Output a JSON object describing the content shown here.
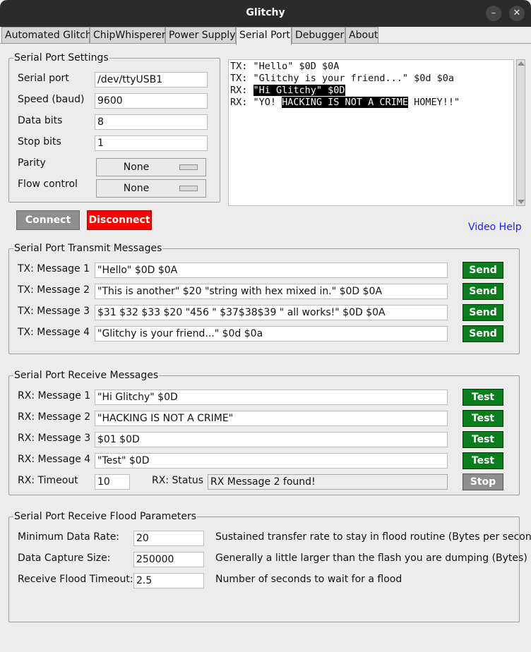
{
  "window": {
    "title": "Glitchy",
    "minimize": "–",
    "close": "✕"
  },
  "tabs": [
    "Automated Glitch",
    "ChipWhisperer",
    "Power Supply",
    "Serial Port",
    "Debugger",
    "About"
  ],
  "active_tab": "Serial Port",
  "settings": {
    "title": "Serial Port Settings",
    "port_label": "Serial port",
    "port_value": "/dev/ttyUSB1",
    "speed_label": "Speed (baud)",
    "speed_value": "9600",
    "databits_label": "Data bits",
    "databits_value": "8",
    "stopbits_label": "Stop bits",
    "stopbits_value": "1",
    "parity_label": "Parity",
    "parity_value": "None",
    "flow_label": "Flow control",
    "flow_value": "None"
  },
  "console": {
    "lines": [
      {
        "prefix": "TX: ",
        "text": "\"Hello\" $0D $0A",
        "hl": "",
        "rest": ""
      },
      {
        "prefix": "TX: ",
        "text": "\"Glitchy is your friend...\" $0d $0a",
        "hl": "",
        "rest": ""
      },
      {
        "prefix": "RX: ",
        "text": "",
        "hl": "\"Hi Glitchy\" $0D",
        "rest": ""
      },
      {
        "prefix": "RX: ",
        "text": "\"YO! ",
        "hl": "HACKING IS NOT A CRIME",
        "rest": " HOMEY!!\""
      }
    ]
  },
  "buttons": {
    "connect": "Connect",
    "disconnect": "Disconnect"
  },
  "video_help": "Video Help",
  "transmit": {
    "title": "Serial Port Transmit Messages",
    "button": "Send",
    "messages": [
      {
        "label": "TX: Message 1",
        "value": "\"Hello\" $0D $0A"
      },
      {
        "label": "TX: Message 2",
        "value": "\"This is another\" $20 \"string with hex mixed in.\" $0D $0A"
      },
      {
        "label": "TX: Message 3",
        "value": "$31 $32 $33 $20 \"456 \" $37$38$39 \" all works!\" $0D $0A"
      },
      {
        "label": "TX: Message 4",
        "value": "\"Glitchy is your friend...\" $0d $0a"
      }
    ]
  },
  "receive": {
    "title": "Serial Port Receive Messages",
    "button": "Test",
    "messages": [
      {
        "label": "RX: Message 1",
        "value": "\"Hi Glitchy\" $0D"
      },
      {
        "label": "RX: Message 2",
        "value": "\"HACKING IS NOT A CRIME\""
      },
      {
        "label": "RX: Message 3",
        "value": "$01 $0D"
      },
      {
        "label": "RX: Message 4",
        "value": "\"Test\" $0D"
      }
    ],
    "timeout_label": "RX: Timeout",
    "timeout_value": "10",
    "status_label": "RX: Status",
    "status_value": "RX Message 2 found!",
    "stop": "Stop"
  },
  "flood": {
    "title": "Serial Port Receive Flood Parameters",
    "rows": [
      {
        "label": "Minimum Data Rate:",
        "value": "20",
        "desc": "Sustained transfer rate to stay in flood routine (Bytes per second)"
      },
      {
        "label": "Data Capture Size:",
        "value": "250000",
        "desc": "Generally a little larger than the flash you are dumping (Bytes)"
      },
      {
        "label": "Receive Flood Timeout:",
        "value": "2.5",
        "desc": "Number of seconds to wait for a flood"
      }
    ]
  },
  "colors": {
    "send_green": "#0a7d1d",
    "disconnect_red": "#ff0000",
    "link_blue": "#1a1aff"
  }
}
